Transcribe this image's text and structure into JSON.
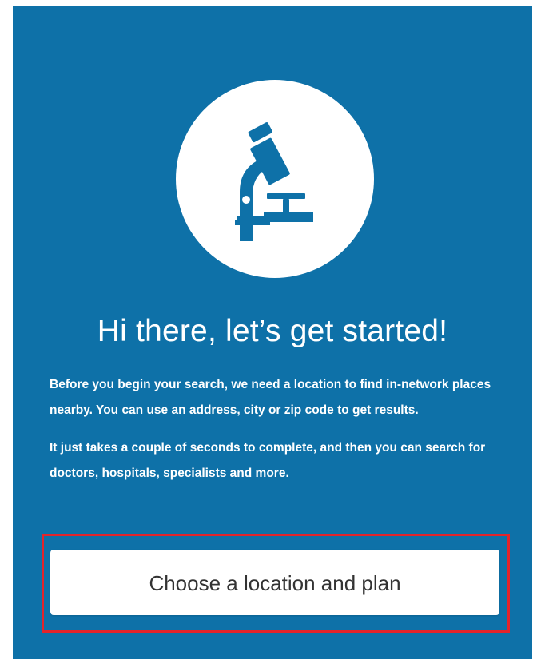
{
  "hero": {
    "icon": "microscope-icon"
  },
  "onboarding": {
    "title": "Hi there, let’s get started!",
    "paragraph_1": "Before you begin your search, we need a location to find in-network places nearby. You can use an address, city or zip code to get results.",
    "paragraph_2": "It just takes a couple of seconds to complete, and then you can search for doctors, hospitals, specialists and more.",
    "cta_label": "Choose a location and plan"
  },
  "colors": {
    "panel_background": "#0e71a8",
    "icon_color": "#0e71a8",
    "highlight_border": "#e3242b",
    "button_text": "#333333"
  }
}
